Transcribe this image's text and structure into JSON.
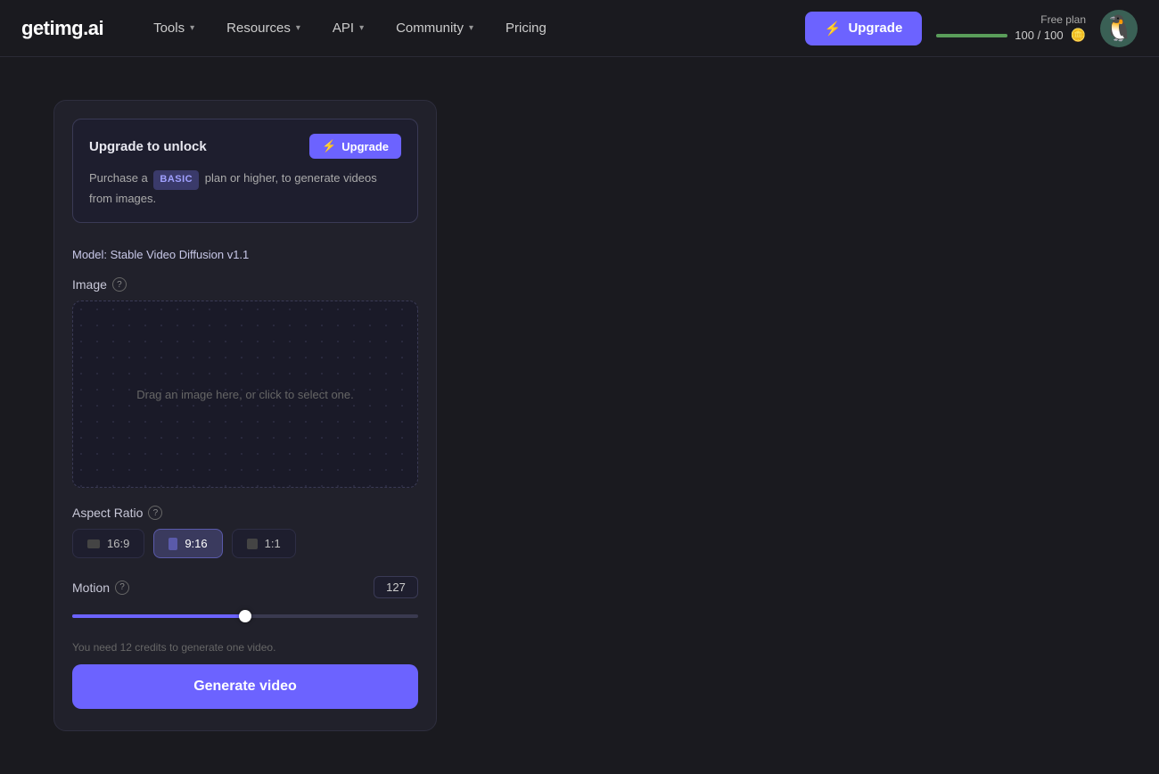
{
  "site": {
    "logo": "getimg.ai"
  },
  "navbar": {
    "items": [
      {
        "label": "Tools",
        "has_dropdown": true
      },
      {
        "label": "Resources",
        "has_dropdown": true
      },
      {
        "label": "API",
        "has_dropdown": true
      },
      {
        "label": "Community",
        "has_dropdown": true
      },
      {
        "label": "Pricing",
        "has_dropdown": false
      }
    ],
    "upgrade_btn": "Upgrade",
    "plan_label": "Free plan",
    "credits_current": "100",
    "credits_separator": "/",
    "credits_max": "100",
    "progress_pct": 100
  },
  "upgrade_box": {
    "title": "Upgrade to unlock",
    "btn_label": "Upgrade",
    "text_before": "Purchase a",
    "badge": "BASIC",
    "text_after": "plan or higher, to generate videos from images."
  },
  "model_row": {
    "label": "Model: ",
    "model_name": "Stable Video Diffusion v1.1"
  },
  "image_section": {
    "label": "Image",
    "dropzone_text": "Drag an image here, or click to select one."
  },
  "aspect_ratio": {
    "label": "Aspect Ratio",
    "options": [
      {
        "label": "16:9",
        "active": false
      },
      {
        "label": "9:16",
        "active": true
      },
      {
        "label": "1:1",
        "active": false
      }
    ]
  },
  "motion": {
    "label": "Motion",
    "value": "127",
    "slider_pct": 50
  },
  "credits_note": "You need 12 credits to generate one video.",
  "generate_btn": "Generate video"
}
